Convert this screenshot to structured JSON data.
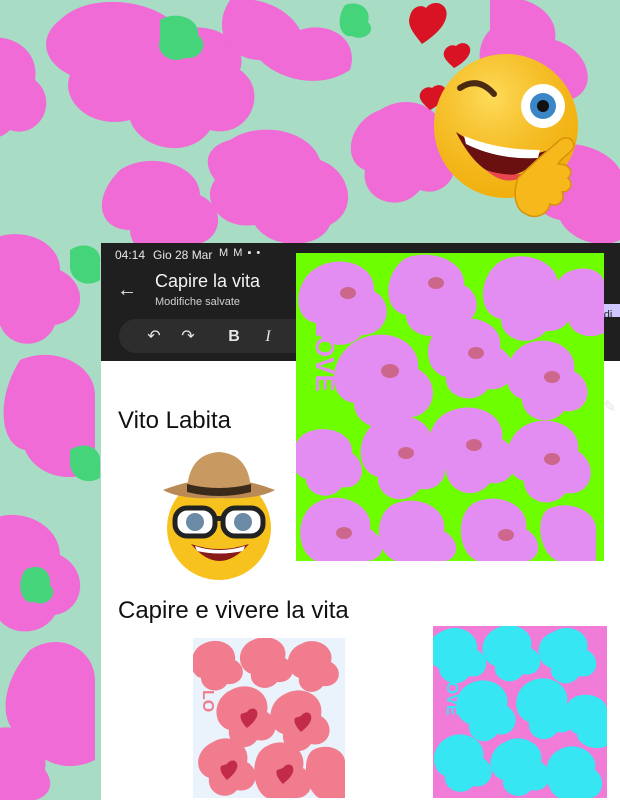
{
  "status_bar": {
    "time": "04:14",
    "date": "Gio 28 Mar",
    "icons_text": "M M ▪ •"
  },
  "app_bar": {
    "title": "Capire la vita",
    "subtitle": "Modifiche salvate",
    "back_icon": "arrow-back-icon",
    "edge_label": "di"
  },
  "toolbar": {
    "undo": "↶",
    "redo": "↷",
    "bold": "B",
    "italic": "I",
    "pencil": "✎"
  },
  "document": {
    "author": "Vito Labita",
    "heading": "Capire e vivere la vita"
  },
  "colors": {
    "background_mint": "#a9dcc4",
    "background_flower": "#f06bd6",
    "neon_green": "#6dff00",
    "pink_art": "#ffb3d0",
    "cyan_art": "#36e6f2",
    "status_bar": "#1f1f1f"
  },
  "art": {
    "love_text": "LOVE"
  }
}
